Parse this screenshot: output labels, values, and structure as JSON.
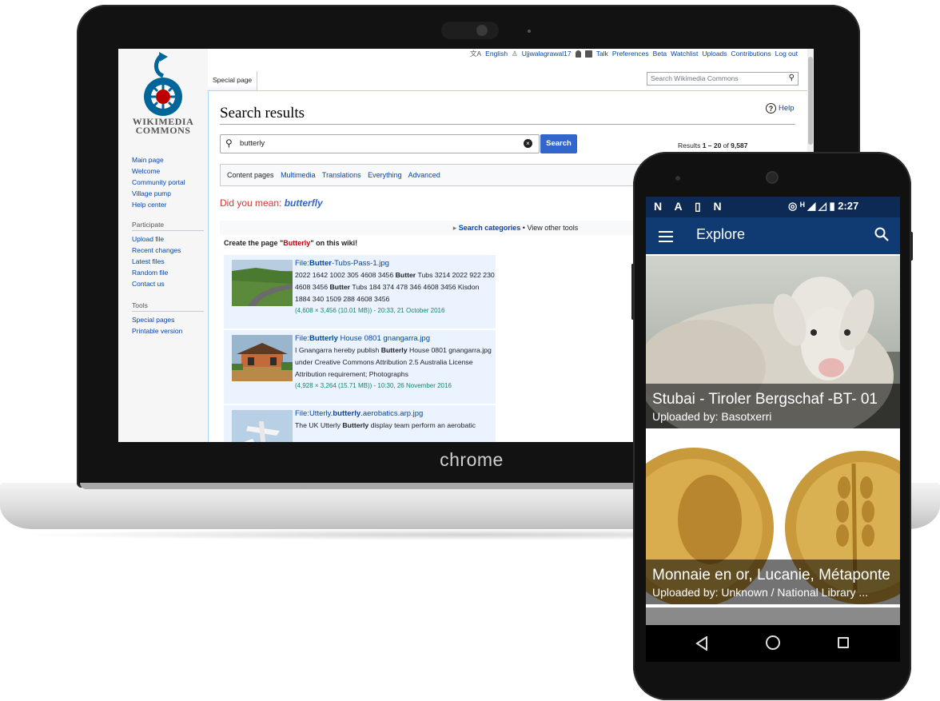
{
  "laptop": {
    "brand": "chrome"
  },
  "wiki": {
    "logo_line1": "WIKIMEDIA",
    "logo_line2": "COMMONS",
    "top_links": {
      "language_glyph": "文A",
      "language": "English",
      "user_glyph": "♙",
      "user": "Ujjwalagrawal17",
      "talk": "Talk",
      "preferences": "Preferences",
      "beta": "Beta",
      "watchlist": "Watchlist",
      "uploads": "Uploads",
      "contributions": "Contributions",
      "logout": "Log out"
    },
    "tab": "Special page",
    "search_placeholder": "Search Wikimedia Commons",
    "search_glyph": "⚲",
    "nav_main": [
      "Main page",
      "Welcome",
      "Community portal",
      "Village pump",
      "Help center"
    ],
    "participate_heading": "Participate",
    "nav_participate": [
      "Upload file",
      "Recent changes",
      "Latest files",
      "Random file",
      "Contact us"
    ],
    "tools_heading": "Tools",
    "nav_tools": [
      "Special pages",
      "Printable version"
    ],
    "page_title": "Search results",
    "help_glyph": "?",
    "help": "Help",
    "query": "butterly",
    "query_glyph": "⚲",
    "clear_glyph": "×",
    "search_button": "Search",
    "results": {
      "prefix": "Results ",
      "range": "1 – 20",
      "of": " of ",
      "total": "9,587"
    },
    "profiles": {
      "content_pages": "Content pages",
      "multimedia": "Multimedia",
      "translations": "Translations",
      "everything": "Everything",
      "advanced": "Advanced"
    },
    "did_you_mean_prefix": "Did you mean: ",
    "did_you_mean_term": "butterfly",
    "search_tools": {
      "arrow": "▸",
      "categories": "Search categories",
      "separator": " • ",
      "other": "View other tools"
    },
    "create_page": {
      "prefix": "Create the page \"",
      "name": "Butterly",
      "suffix": "\" on this wiki!"
    },
    "items": [
      {
        "title_prefix": "File:",
        "title_bold": "Butter",
        "title_rest": "-Tubs-Pass-1.jpg",
        "snippet_1": "2022 1642 1002 305 4608 3456 ",
        "snippet_bold_1": "Butter",
        "snippet_2": " Tubs 3214 2022 922 230 4608 3456 ",
        "snippet_bold_2": "Butter",
        "snippet_3": " Tubs 184 374 478 346 4608 3456 Kisdon 1884 340 1509 288 4608 3456",
        "meta": "(4,608 × 3,456 (10.01 MB)) - 20:33, 21 October 2016"
      },
      {
        "title_prefix": "File:",
        "title_bold": "Butterly",
        "title_rest": " House 0801 gnangarra.jpg",
        "snippet_1": "I Gnangarra hereby publish ",
        "snippet_bold_1": "Butterly",
        "snippet_2": " House 0801 gnangarra.jpg under Creative Commons Attribution 2.5 Australia License Attribution requirement; Photographs",
        "meta": "(4,928 × 3,264 (15.71 MB)) - 10:30, 26 November 2016"
      },
      {
        "title_prefix": "File:Utterly.",
        "title_bold": "butterly",
        "title_rest": ".aerobatics.arp.jpg",
        "snippet_1": "The UK Utterly ",
        "snippet_bold_1": "Butterly",
        "snippet_2": " display team perform an aerobatic"
      }
    ]
  },
  "phone": {
    "status_left": "N A ▯ N",
    "status_right": "◎ ᴴ ◢ ◿ ▮ 2:27",
    "title": "Explore",
    "cards": [
      {
        "title": "Stubai - Tiroler Bergschaf -BT- 01",
        "subtitle": "Uploaded by: Basotxerri"
      },
      {
        "title": "Monnaie en or, Lucanie, Métaponte",
        "subtitle": "Uploaded by: Unknown / National Library ..."
      }
    ]
  },
  "colors": {
    "link": "#0645ad",
    "accent": "#3366cc",
    "phone_toolbar": "#103a72",
    "phone_statusbar": "#0d2a55",
    "meta_green": "#14866d"
  }
}
